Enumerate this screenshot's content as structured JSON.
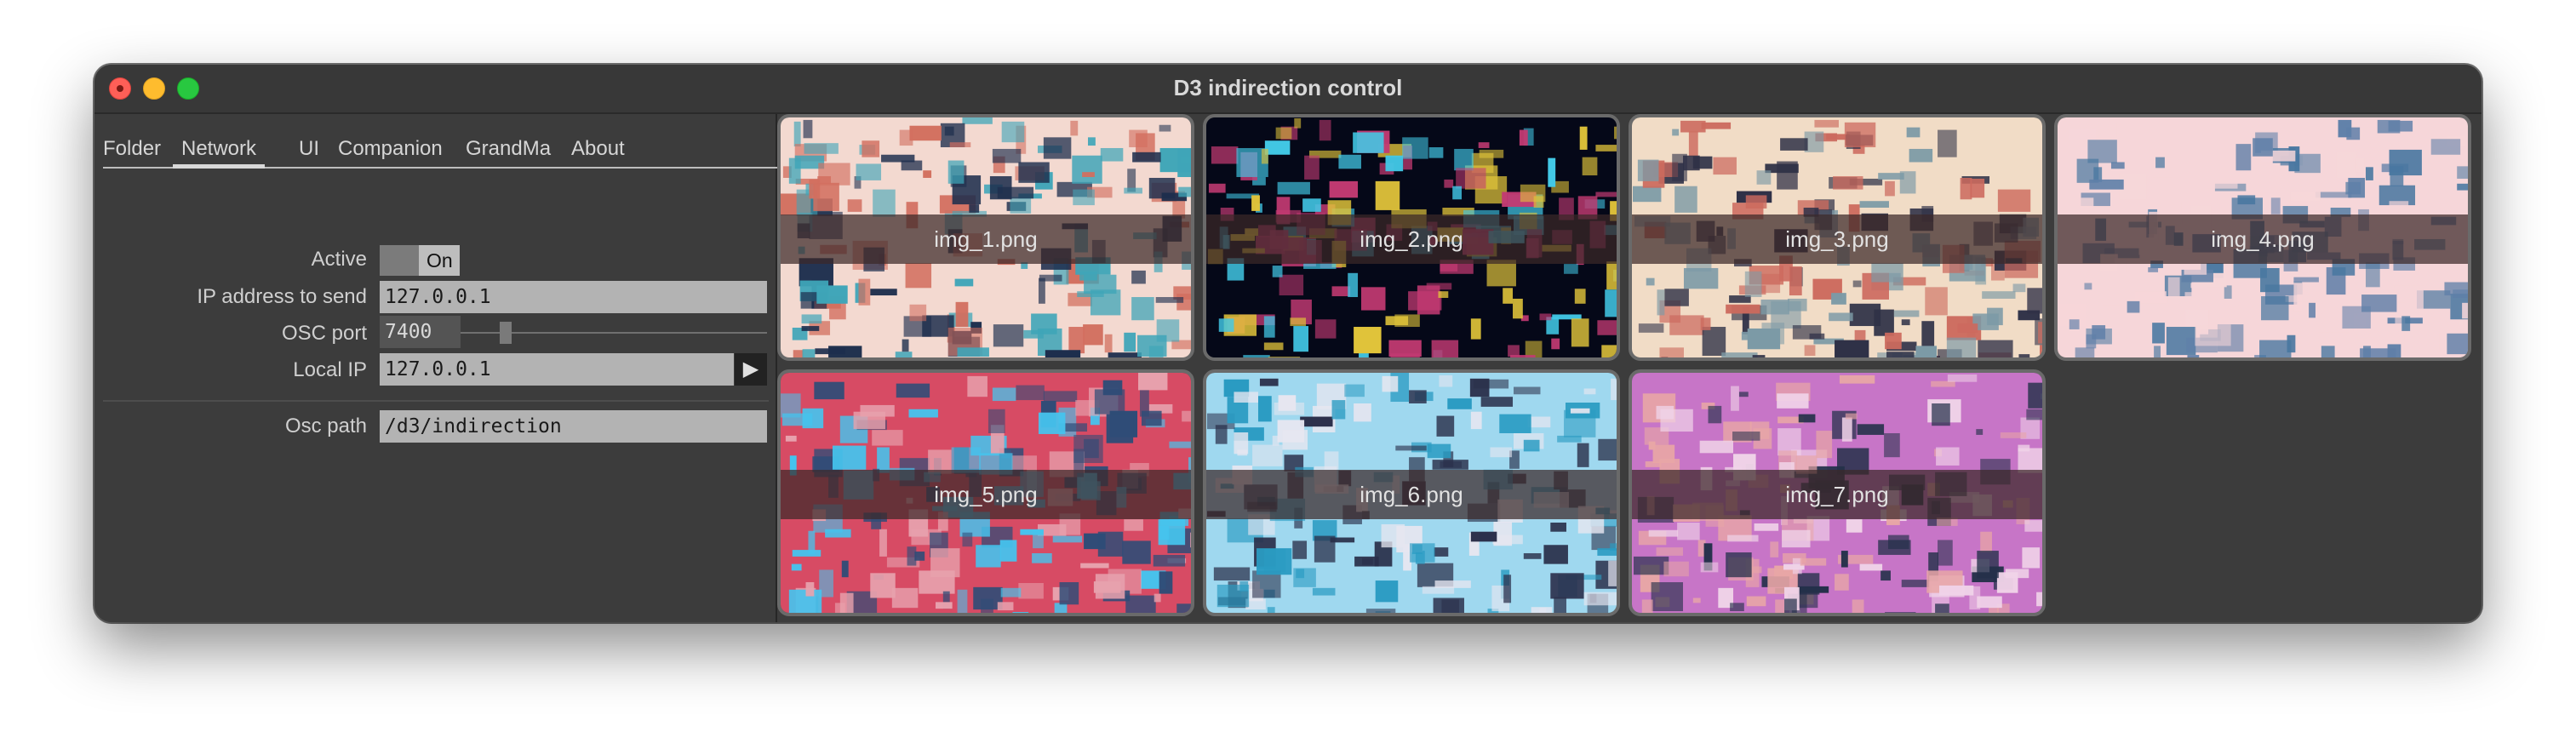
{
  "window": {
    "title": "D3 indirection control"
  },
  "tabs": [
    {
      "label": "Folder"
    },
    {
      "label": "Network",
      "active": true
    },
    {
      "label": "UI"
    },
    {
      "label": "Companion"
    },
    {
      "label": "GrandMa"
    },
    {
      "label": "About"
    }
  ],
  "network": {
    "active_label": "Active",
    "active_value": "On",
    "ip_label": "IP address to send",
    "ip_value": "127.0.0.1",
    "osc_port_label": "OSC port",
    "osc_port_value": "7400",
    "local_ip_label": "Local IP",
    "local_ip_value": "127.0.0.1",
    "send_icon": "play-icon",
    "osc_path_label": "Osc path",
    "osc_path_value": "/d3/indirection"
  },
  "images": [
    {
      "name": "img_1.png",
      "palette": [
        "#f3d9d0",
        "#3fa5b8",
        "#d26f5f",
        "#1d2e4d"
      ]
    },
    {
      "name": "img_2.png",
      "palette": [
        "#050818",
        "#42c8e6",
        "#e0c33a",
        "#c23a72"
      ]
    },
    {
      "name": "img_3.png",
      "palette": [
        "#f1dcc6",
        "#cc6a5e",
        "#7c9aa6",
        "#2f3147"
      ]
    },
    {
      "name": "img_4.png",
      "palette": [
        "#f6d6d9",
        "#4877a0",
        "#5f7fa8",
        "#f6d6d9"
      ]
    },
    {
      "name": "img_5.png",
      "palette": [
        "#d74b64",
        "#45c4ee",
        "#2f4c77",
        "#e7a1ad"
      ]
    },
    {
      "name": "img_6.png",
      "palette": [
        "#9fd8ef",
        "#2a9bc2",
        "#2a2f4a",
        "#e6e6f0"
      ]
    },
    {
      "name": "img_7.png",
      "palette": [
        "#c775c7",
        "#e8a6a6",
        "#233049",
        "#f0d3e8"
      ]
    }
  ]
}
